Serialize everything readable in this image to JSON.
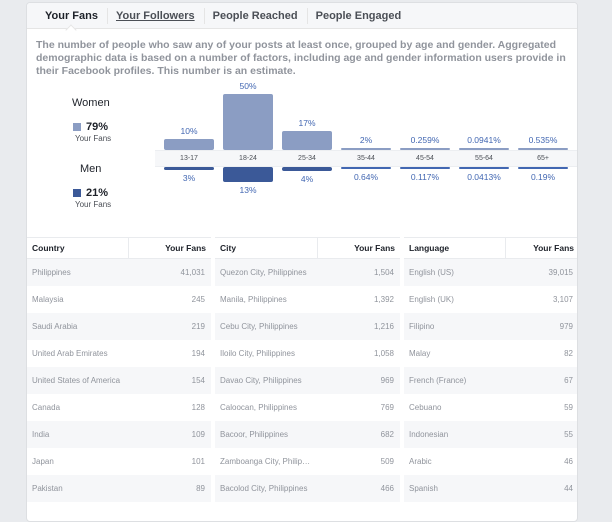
{
  "tabs": [
    {
      "label": "Your Fans",
      "active": true
    },
    {
      "label": "Your Followers",
      "underlined": true
    },
    {
      "label": "People Reached"
    },
    {
      "label": "People Engaged"
    }
  ],
  "description": "The number of people who saw any of your posts at least once, grouped by age and gender. Aggregated demographic data is based on a number of factors, including age and gender information users provide in their Facebook profiles. This number is an estimate.",
  "legend": {
    "women": {
      "label": "Women",
      "pct": "79%",
      "sub": "Your Fans",
      "color": "#8b9dc3"
    },
    "men": {
      "label": "Men",
      "pct": "21%",
      "sub": "Your Fans",
      "color": "#3b5998"
    }
  },
  "chart_data": {
    "type": "bar",
    "categories": [
      "13-17",
      "18-24",
      "25-34",
      "35-44",
      "45-54",
      "55-64",
      "65+"
    ],
    "series": [
      {
        "name": "Women",
        "values": [
          10,
          50,
          17,
          2,
          0.259,
          0.0941,
          0.535
        ],
        "labels": [
          "10%",
          "50%",
          "17%",
          "2%",
          "0.259%",
          "0.0941%",
          "0.535%"
        ],
        "color": "#8b9dc3"
      },
      {
        "name": "Men",
        "values": [
          3,
          13,
          4,
          0.64,
          0.117,
          0.0413,
          0.19
        ],
        "labels": [
          "3%",
          "13%",
          "4%",
          "0.64%",
          "0.117%",
          "0.0413%",
          "0.19%"
        ],
        "color": "#3b5998"
      }
    ],
    "title": "",
    "xlabel": "",
    "ylabel": "",
    "unit": "%"
  },
  "tables": [
    {
      "col1": "Country",
      "col2": "Your Fans",
      "rows": [
        [
          "Philippines",
          "41,031"
        ],
        [
          "Malaysia",
          "245"
        ],
        [
          "Saudi Arabia",
          "219"
        ],
        [
          "United Arab Emirates",
          "194"
        ],
        [
          "United States of America",
          "154"
        ],
        [
          "Canada",
          "128"
        ],
        [
          "India",
          "109"
        ],
        [
          "Japan",
          "101"
        ],
        [
          "Pakistan",
          "89"
        ]
      ]
    },
    {
      "col1": "City",
      "col2": "Your Fans",
      "rows": [
        [
          "Quezon City, Philippines",
          "1,504"
        ],
        [
          "Manila, Philippines",
          "1,392"
        ],
        [
          "Cebu City, Philippines",
          "1,216"
        ],
        [
          "Iloilo City, Philippines",
          "1,058"
        ],
        [
          "Davao City, Philippines",
          "969"
        ],
        [
          "Caloocan, Philippines",
          "769"
        ],
        [
          "Bacoor, Philippines",
          "682"
        ],
        [
          "Zamboanga City, Philip…",
          "509"
        ],
        [
          "Bacolod City, Philippines",
          "466"
        ]
      ]
    },
    {
      "col1": "Language",
      "col2": "Your Fans",
      "rows": [
        [
          "English (US)",
          "39,015"
        ],
        [
          "English (UK)",
          "3,107"
        ],
        [
          "Filipino",
          "979"
        ],
        [
          "Malay",
          "82"
        ],
        [
          "French (France)",
          "67"
        ],
        [
          "Cebuano",
          "59"
        ],
        [
          "Indonesian",
          "55"
        ],
        [
          "Arabic",
          "46"
        ],
        [
          "Spanish",
          "44"
        ]
      ]
    }
  ]
}
